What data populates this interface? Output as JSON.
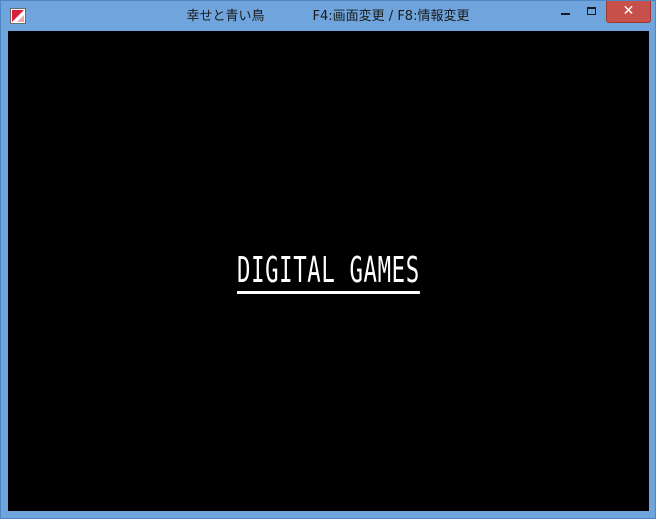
{
  "window": {
    "app_name": "幸せと青い鳥",
    "hotkeys": "F4:画面変更 / F8:情報変更",
    "icon": "app-icon",
    "controls": {
      "minimize_icon": "minimize-icon",
      "maximize_icon": "maximize-icon",
      "close_icon": "close-icon",
      "close_glyph": "✕",
      "close_color": "#c7504a"
    },
    "titlebar_color": "#6fa5dc"
  },
  "screen": {
    "background": "#000000",
    "logo_text": "DIGITAL GAMES",
    "logo_color": "#ffffff"
  }
}
